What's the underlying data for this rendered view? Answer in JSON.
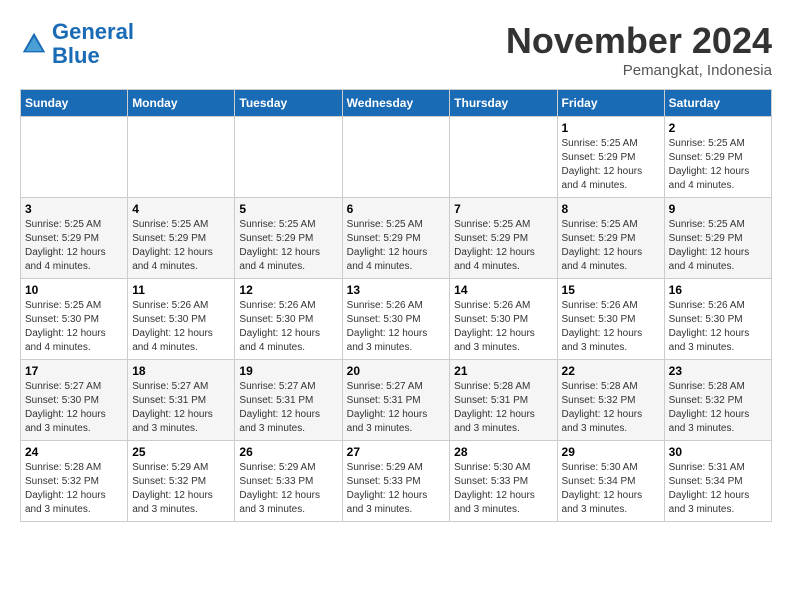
{
  "logo": {
    "line1": "General",
    "line2": "Blue"
  },
  "title": "November 2024",
  "location": "Pemangkat, Indonesia",
  "weekdays": [
    "Sunday",
    "Monday",
    "Tuesday",
    "Wednesday",
    "Thursday",
    "Friday",
    "Saturday"
  ],
  "weeks": [
    [
      {
        "day": "",
        "info": ""
      },
      {
        "day": "",
        "info": ""
      },
      {
        "day": "",
        "info": ""
      },
      {
        "day": "",
        "info": ""
      },
      {
        "day": "",
        "info": ""
      },
      {
        "day": "1",
        "info": "Sunrise: 5:25 AM\nSunset: 5:29 PM\nDaylight: 12 hours\nand 4 minutes."
      },
      {
        "day": "2",
        "info": "Sunrise: 5:25 AM\nSunset: 5:29 PM\nDaylight: 12 hours\nand 4 minutes."
      }
    ],
    [
      {
        "day": "3",
        "info": "Sunrise: 5:25 AM\nSunset: 5:29 PM\nDaylight: 12 hours\nand 4 minutes."
      },
      {
        "day": "4",
        "info": "Sunrise: 5:25 AM\nSunset: 5:29 PM\nDaylight: 12 hours\nand 4 minutes."
      },
      {
        "day": "5",
        "info": "Sunrise: 5:25 AM\nSunset: 5:29 PM\nDaylight: 12 hours\nand 4 minutes."
      },
      {
        "day": "6",
        "info": "Sunrise: 5:25 AM\nSunset: 5:29 PM\nDaylight: 12 hours\nand 4 minutes."
      },
      {
        "day": "7",
        "info": "Sunrise: 5:25 AM\nSunset: 5:29 PM\nDaylight: 12 hours\nand 4 minutes."
      },
      {
        "day": "8",
        "info": "Sunrise: 5:25 AM\nSunset: 5:29 PM\nDaylight: 12 hours\nand 4 minutes."
      },
      {
        "day": "9",
        "info": "Sunrise: 5:25 AM\nSunset: 5:29 PM\nDaylight: 12 hours\nand 4 minutes."
      }
    ],
    [
      {
        "day": "10",
        "info": "Sunrise: 5:25 AM\nSunset: 5:30 PM\nDaylight: 12 hours\nand 4 minutes."
      },
      {
        "day": "11",
        "info": "Sunrise: 5:26 AM\nSunset: 5:30 PM\nDaylight: 12 hours\nand 4 minutes."
      },
      {
        "day": "12",
        "info": "Sunrise: 5:26 AM\nSunset: 5:30 PM\nDaylight: 12 hours\nand 4 minutes."
      },
      {
        "day": "13",
        "info": "Sunrise: 5:26 AM\nSunset: 5:30 PM\nDaylight: 12 hours\nand 3 minutes."
      },
      {
        "day": "14",
        "info": "Sunrise: 5:26 AM\nSunset: 5:30 PM\nDaylight: 12 hours\nand 3 minutes."
      },
      {
        "day": "15",
        "info": "Sunrise: 5:26 AM\nSunset: 5:30 PM\nDaylight: 12 hours\nand 3 minutes."
      },
      {
        "day": "16",
        "info": "Sunrise: 5:26 AM\nSunset: 5:30 PM\nDaylight: 12 hours\nand 3 minutes."
      }
    ],
    [
      {
        "day": "17",
        "info": "Sunrise: 5:27 AM\nSunset: 5:30 PM\nDaylight: 12 hours\nand 3 minutes."
      },
      {
        "day": "18",
        "info": "Sunrise: 5:27 AM\nSunset: 5:31 PM\nDaylight: 12 hours\nand 3 minutes."
      },
      {
        "day": "19",
        "info": "Sunrise: 5:27 AM\nSunset: 5:31 PM\nDaylight: 12 hours\nand 3 minutes."
      },
      {
        "day": "20",
        "info": "Sunrise: 5:27 AM\nSunset: 5:31 PM\nDaylight: 12 hours\nand 3 minutes."
      },
      {
        "day": "21",
        "info": "Sunrise: 5:28 AM\nSunset: 5:31 PM\nDaylight: 12 hours\nand 3 minutes."
      },
      {
        "day": "22",
        "info": "Sunrise: 5:28 AM\nSunset: 5:32 PM\nDaylight: 12 hours\nand 3 minutes."
      },
      {
        "day": "23",
        "info": "Sunrise: 5:28 AM\nSunset: 5:32 PM\nDaylight: 12 hours\nand 3 minutes."
      }
    ],
    [
      {
        "day": "24",
        "info": "Sunrise: 5:28 AM\nSunset: 5:32 PM\nDaylight: 12 hours\nand 3 minutes."
      },
      {
        "day": "25",
        "info": "Sunrise: 5:29 AM\nSunset: 5:32 PM\nDaylight: 12 hours\nand 3 minutes."
      },
      {
        "day": "26",
        "info": "Sunrise: 5:29 AM\nSunset: 5:33 PM\nDaylight: 12 hours\nand 3 minutes."
      },
      {
        "day": "27",
        "info": "Sunrise: 5:29 AM\nSunset: 5:33 PM\nDaylight: 12 hours\nand 3 minutes."
      },
      {
        "day": "28",
        "info": "Sunrise: 5:30 AM\nSunset: 5:33 PM\nDaylight: 12 hours\nand 3 minutes."
      },
      {
        "day": "29",
        "info": "Sunrise: 5:30 AM\nSunset: 5:34 PM\nDaylight: 12 hours\nand 3 minutes."
      },
      {
        "day": "30",
        "info": "Sunrise: 5:31 AM\nSunset: 5:34 PM\nDaylight: 12 hours\nand 3 minutes."
      }
    ]
  ]
}
